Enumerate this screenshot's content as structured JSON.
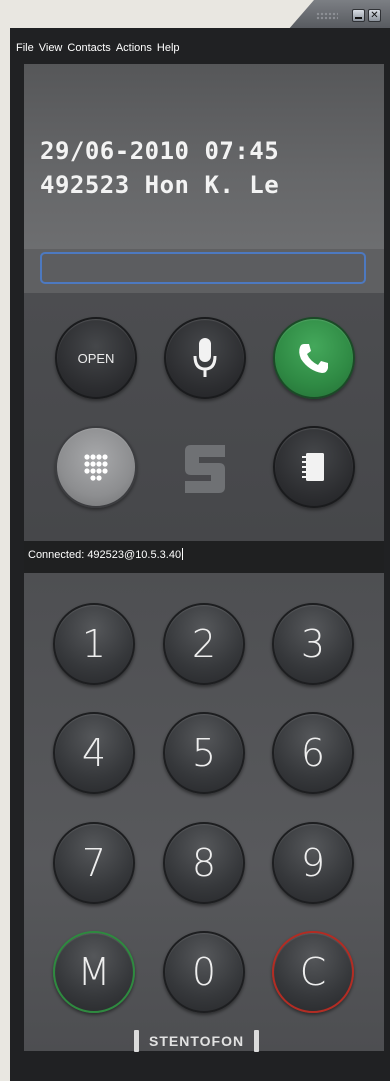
{
  "titlebar": {
    "minimize_icon": "minimize-icon",
    "close_icon": "close-icon",
    "close_label": "✕"
  },
  "menu": {
    "items": [
      "File",
      "View",
      "Contacts",
      "Actions",
      "Help"
    ]
  },
  "display": {
    "line1": "29/06-2010 07:45",
    "line2": "492523 Hon K. Le"
  },
  "dial_input": {
    "value": ""
  },
  "controls": {
    "open_label": "OPEN",
    "microphone_icon": "microphone-icon",
    "call_icon": "phone-handset-icon",
    "keypad_icon": "keypad-grid-icon",
    "logo_icon": "stentofon-s-logo-icon",
    "contacts_icon": "address-book-icon"
  },
  "status": {
    "text": "Connected: 492523@10.5.3.40"
  },
  "keypad": {
    "keys": [
      "1",
      "2",
      "3",
      "4",
      "5",
      "6",
      "7",
      "8",
      "9",
      "M",
      "0",
      "C"
    ],
    "memory_color": "#2e8a3f",
    "clear_color": "#b32c23"
  },
  "brand": {
    "text": "STENTOFON"
  },
  "colors": {
    "frame": "#202123",
    "display": "#666769",
    "call_green": "#2f8a44",
    "input_focus": "#4d79c0"
  }
}
